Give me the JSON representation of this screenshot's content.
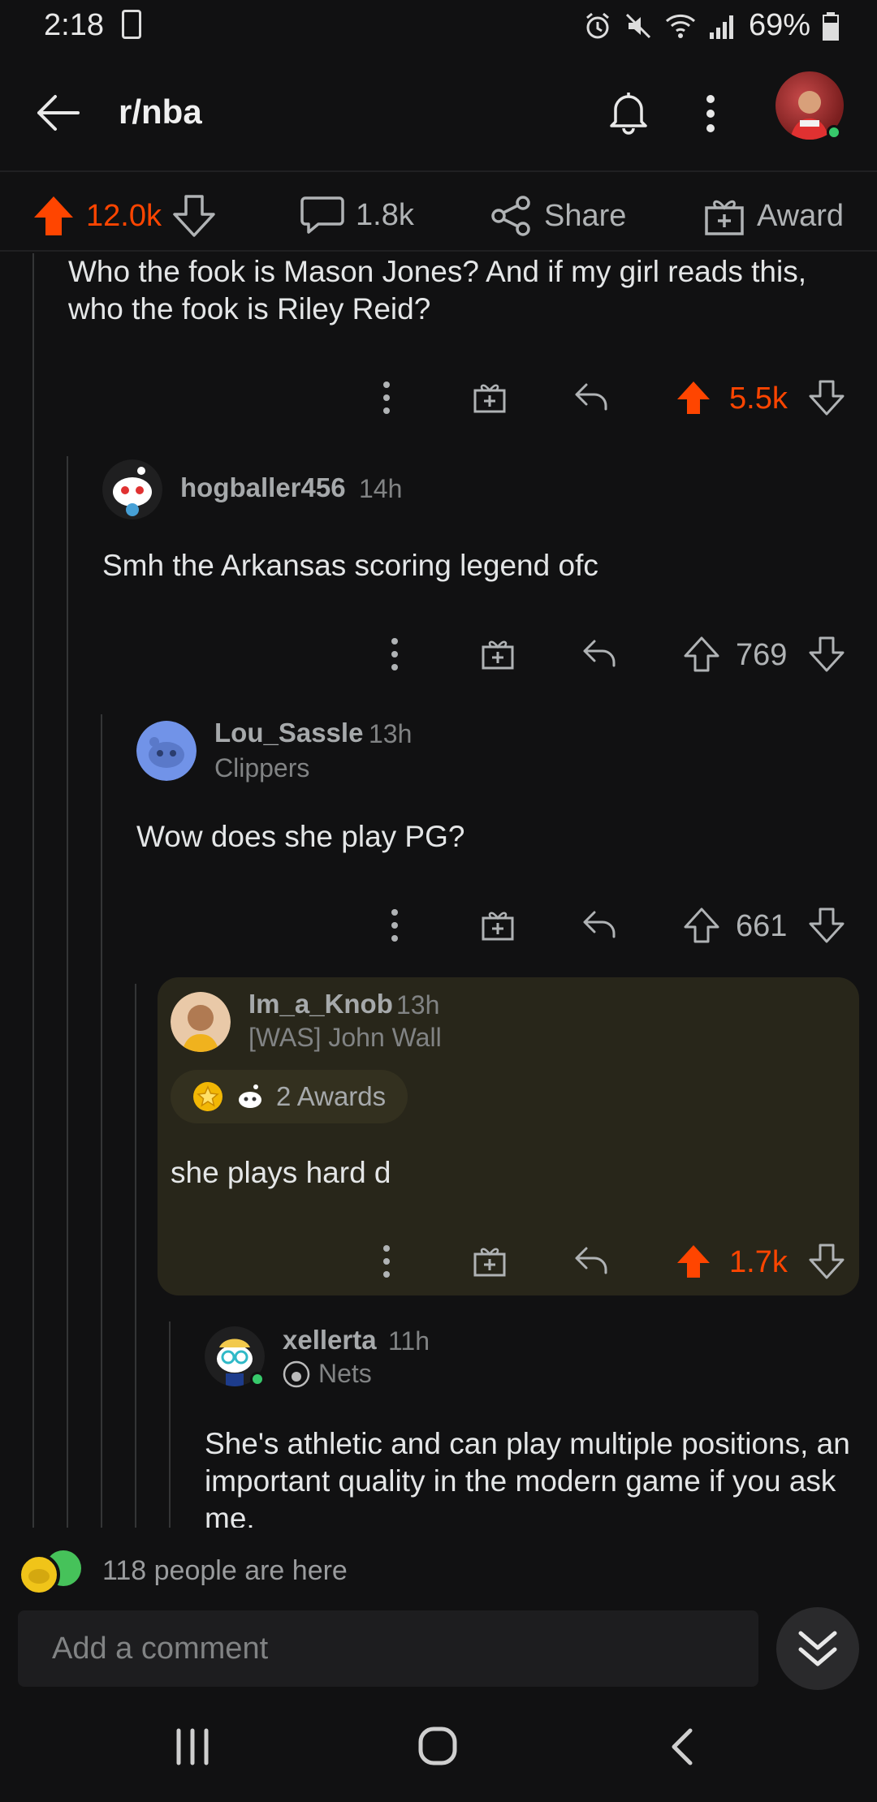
{
  "status_bar": {
    "time": "2:18",
    "battery": "69%"
  },
  "header": {
    "title": "r/nba"
  },
  "post_actions": {
    "score": "12.0k",
    "comments": "1.8k",
    "share_label": "Share",
    "award_label": "Award"
  },
  "comments": [
    {
      "text": "Who the fook is Mason Jones?  And if my girl reads this, who the fook is Riley Reid?",
      "score": "5.5k"
    },
    {
      "user": "hogballer456",
      "time": "14h",
      "text": "Smh the Arkansas scoring legend ofc",
      "score": "769"
    },
    {
      "user": "Lou_Sassle",
      "time": "13h",
      "flair": "Clippers",
      "text": "Wow does she play PG?",
      "score": "661"
    },
    {
      "user": "Im_a_Knob",
      "time": "13h",
      "flair": "[WAS] John Wall",
      "awards": "2 Awards",
      "text": "she plays hard d",
      "score": "1.7k"
    },
    {
      "user": "xellerta",
      "time": "11h",
      "flair": "Nets",
      "text": "She's athletic and can play multiple positions, an important quality in the modern game if you ask me."
    }
  ],
  "presence": {
    "text": "118 people are here"
  },
  "comment_box": {
    "placeholder": "Add a comment"
  },
  "colors": {
    "upvote": "#ff4500",
    "background": "#111112",
    "highlight": "#28261a"
  }
}
